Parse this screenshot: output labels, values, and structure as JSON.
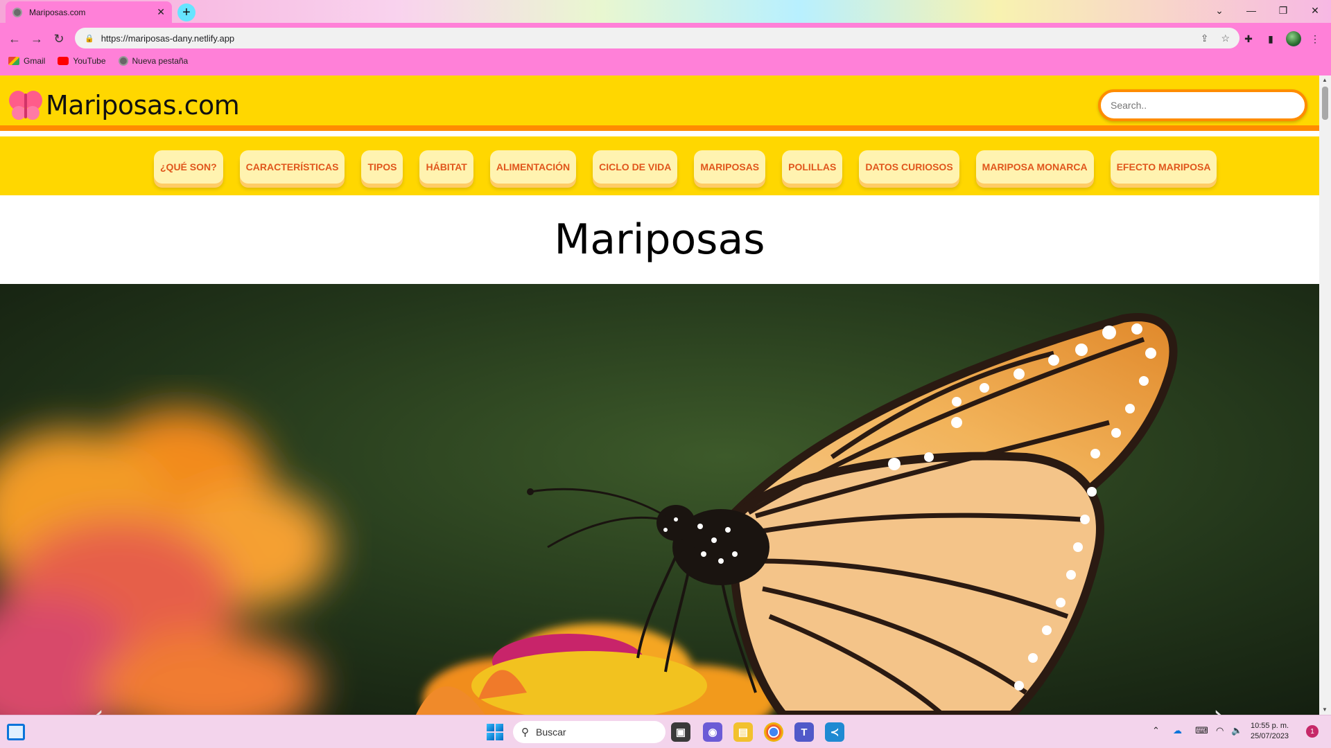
{
  "browser": {
    "tab_title": "Mariposas.com",
    "tab_close": "✕",
    "new_tab": "+",
    "url": "https://mariposas-dany.netlify.app",
    "bookmarks": [
      {
        "label": "Gmail"
      },
      {
        "label": "YouTube"
      },
      {
        "label": "Nueva pestaña"
      }
    ]
  },
  "site": {
    "logo_text": "Mariposas.com",
    "search_placeholder": "Search..",
    "menu": [
      "¿QUÉ SON?",
      "CARACTERÍSTICAS",
      "TIPOS",
      "HÁBITAT",
      "ALIMENTACIÓN",
      "CICLO DE VIDA",
      "MARIPOSAS",
      "POLILLAS",
      "DATOS CURIOSOS",
      "MARIPOSA MONARCA",
      "EFECTO MARIPOSA"
    ],
    "page_title": "Mariposas",
    "carousel": {
      "prev": "‹",
      "next": "›"
    },
    "colors": {
      "header": "#ffd700",
      "accent": "#ff8c00",
      "menu_text": "#e0561c",
      "chrome": "#ff80d8"
    }
  },
  "taskbar": {
    "search_label": "Buscar",
    "time": "10:55 p. m.",
    "date": "25/07/2023",
    "notification_count": "1"
  }
}
